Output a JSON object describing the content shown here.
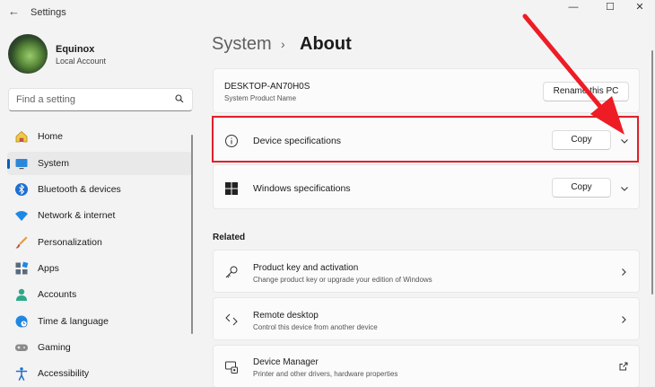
{
  "window": {
    "title": "Settings",
    "back_glyph": "←",
    "minimize_glyph": "—",
    "maximize_glyph": "☐",
    "close_glyph": "✕"
  },
  "user": {
    "name": "Equinox",
    "account_type": "Local Account"
  },
  "search": {
    "placeholder": "Find a setting",
    "icon": "search-icon"
  },
  "nav": {
    "items": [
      {
        "label": "Home",
        "icon": "home-icon",
        "active": false
      },
      {
        "label": "System",
        "icon": "system-icon",
        "active": true
      },
      {
        "label": "Bluetooth & devices",
        "icon": "bluetooth-icon",
        "active": false
      },
      {
        "label": "Network & internet",
        "icon": "wifi-icon",
        "active": false
      },
      {
        "label": "Personalization",
        "icon": "brush-icon",
        "active": false
      },
      {
        "label": "Apps",
        "icon": "apps-icon",
        "active": false
      },
      {
        "label": "Accounts",
        "icon": "accounts-icon",
        "active": false
      },
      {
        "label": "Time & language",
        "icon": "globe-icon",
        "active": false
      },
      {
        "label": "Gaming",
        "icon": "gamepad-icon",
        "active": false
      },
      {
        "label": "Accessibility",
        "icon": "accessibility-icon",
        "active": false
      }
    ]
  },
  "header": {
    "breadcrumb_parent": "System",
    "separator": "›",
    "title": "About"
  },
  "device": {
    "name": "DESKTOP-AN70H0S",
    "subtitle": "System Product Name",
    "rename_label": "Rename this PC"
  },
  "specs": {
    "device": {
      "label": "Device specifications",
      "copy_label": "Copy",
      "icon": "info-icon"
    },
    "windows": {
      "label": "Windows specifications",
      "copy_label": "Copy",
      "icon": "windows-icon"
    }
  },
  "related": {
    "heading": "Related",
    "items": [
      {
        "title": "Product key and activation",
        "description": "Change product key or upgrade your edition of Windows",
        "icon": "key-icon",
        "action": "chevron-right-icon"
      },
      {
        "title": "Remote desktop",
        "description": "Control this device from another device",
        "icon": "remote-desktop-icon",
        "action": "chevron-right-icon"
      },
      {
        "title": "Device Manager",
        "description": "Printer and other drivers, hardware properties",
        "icon": "device-manager-icon",
        "action": "external-link-icon"
      }
    ]
  },
  "colors": {
    "accent": "#005fb8",
    "highlight": "#e0202a",
    "background": "#f3f3f3"
  }
}
